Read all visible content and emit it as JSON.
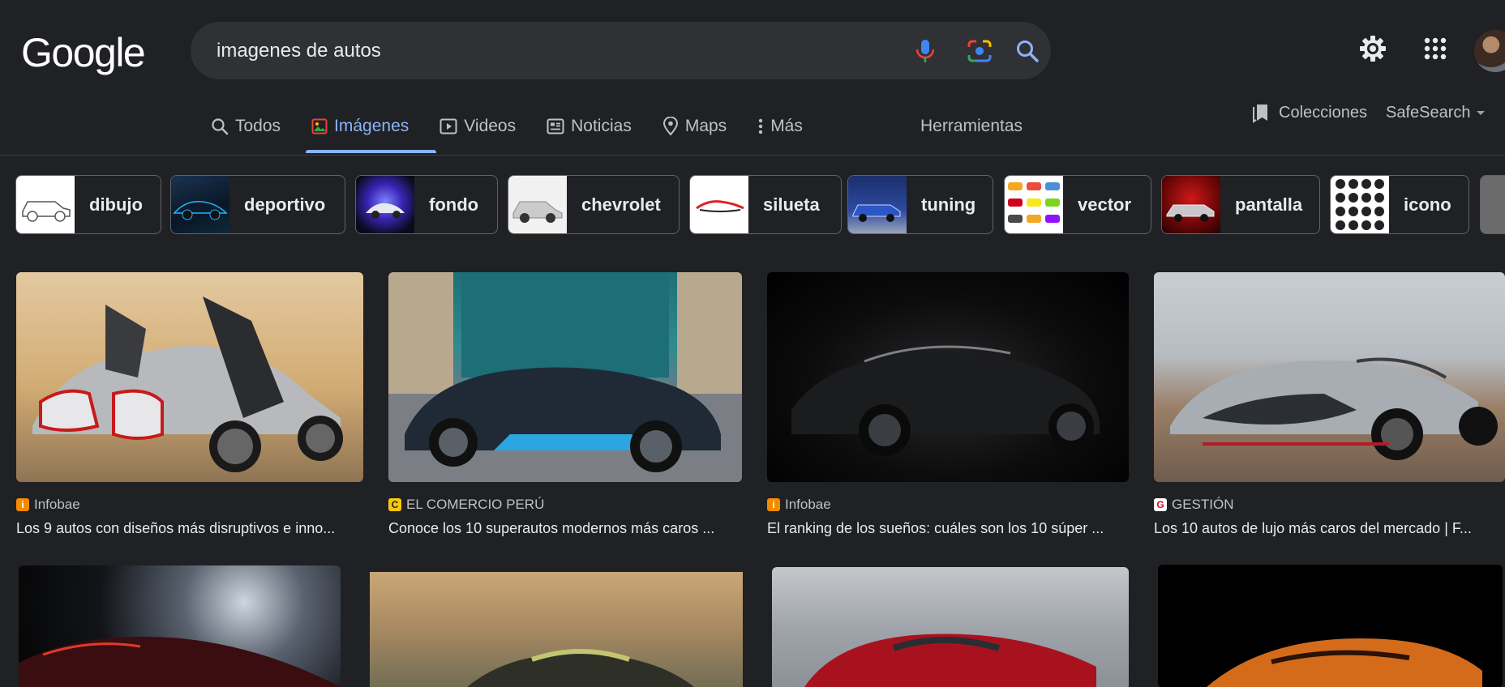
{
  "header": {
    "logo_text": "Google",
    "search_query": "imagenes de autos",
    "icons": [
      "mic-icon",
      "lens-icon",
      "search-icon",
      "settings-icon",
      "apps-icon"
    ]
  },
  "tabs": [
    {
      "label": "Todos",
      "icon": "search-icon",
      "active": false
    },
    {
      "label": "Imágenes",
      "icon": "image-icon",
      "active": true
    },
    {
      "label": "Videos",
      "icon": "play-icon",
      "active": false
    },
    {
      "label": "Noticias",
      "icon": "news-icon",
      "active": false
    },
    {
      "label": "Maps",
      "icon": "map-pin-icon",
      "active": false
    },
    {
      "label": "Más",
      "icon": "more-vertical-icon",
      "active": false
    }
  ],
  "tools_label": "Herramientas",
  "collections_label": "Colecciones",
  "safesearch_label": "SafeSearch",
  "chips": [
    {
      "label": "dibujo"
    },
    {
      "label": "deportivo"
    },
    {
      "label": "fondo"
    },
    {
      "label": "chevrolet"
    },
    {
      "label": "silueta"
    },
    {
      "label": "tuning"
    },
    {
      "label": "vector"
    },
    {
      "label": "pantalla"
    },
    {
      "label": "icono"
    }
  ],
  "results": [
    {
      "source": "Infobae",
      "favicon": "i",
      "favicon_color": "#f28b00",
      "title": "Los 9 autos con diseños más disruptivos e inno..."
    },
    {
      "source": "EL COMERCIO PERÚ",
      "favicon": "C",
      "favicon_color": "#f9c70c",
      "title": "Conoce los 10 superautos modernos más caros ..."
    },
    {
      "source": "Infobae",
      "favicon": "i",
      "favicon_color": "#f28b00",
      "title": "El ranking de los sueños: cuáles son los 10 súper ..."
    },
    {
      "source": "GESTIÓN",
      "favicon": "G",
      "favicon_color": "#ffffff",
      "title": "Los 10 autos de lujo más caros del mercado | F..."
    }
  ],
  "colors": {
    "background": "#202124",
    "accent": "#8ab4f8",
    "text": "#e8eaed",
    "muted": "#bdc1c6"
  }
}
